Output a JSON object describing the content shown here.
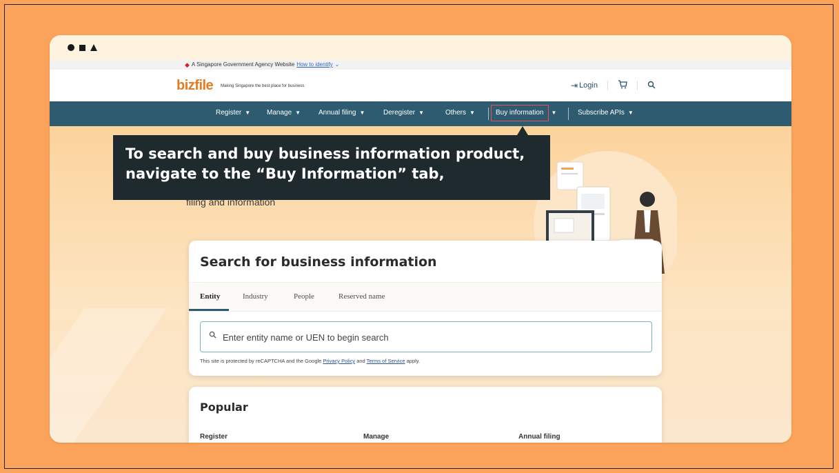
{
  "gov_bar": {
    "text": "A Singapore Government Agency Website",
    "link": "How to identify",
    "caret": "⌄"
  },
  "header": {
    "logo_prefix": "biz",
    "logo_suffix": "file",
    "tagline": "Making Singapore the best place for business",
    "login_label": "Login"
  },
  "nav": {
    "items": [
      {
        "label": "Register"
      },
      {
        "label": "Manage"
      },
      {
        "label": "Annual filing"
      },
      {
        "label": "Deregister"
      },
      {
        "label": "Others"
      },
      {
        "label": "Buy information"
      },
      {
        "label": "Subscribe APIs"
      }
    ]
  },
  "callout": {
    "line1": "To search and buy business information product,",
    "line2": "navigate to the “Buy Information” tab,"
  },
  "hero": {
    "subtitle": "filing and information"
  },
  "search_card": {
    "title": "Search for business information",
    "tabs": [
      "Entity",
      "Industry",
      "People",
      "Reserved name"
    ],
    "placeholder": "Enter entity name or UEN to begin search",
    "recaptcha_prefix": "This site is protected by reCAPTCHA and the Google ",
    "privacy_link": "Privacy Policy",
    "and_text": " and ",
    "terms_link": "Terms of Service",
    "suffix": " apply."
  },
  "popular": {
    "title": "Popular",
    "columns": [
      "Register",
      "Manage",
      "Annual filing"
    ]
  },
  "colors": {
    "page_bg": "#FBA35A",
    "nav_bg": "#2E5B70",
    "logo": "#E9791F",
    "callout_bg": "#1F2A2E",
    "highlight": "#E5535B"
  }
}
